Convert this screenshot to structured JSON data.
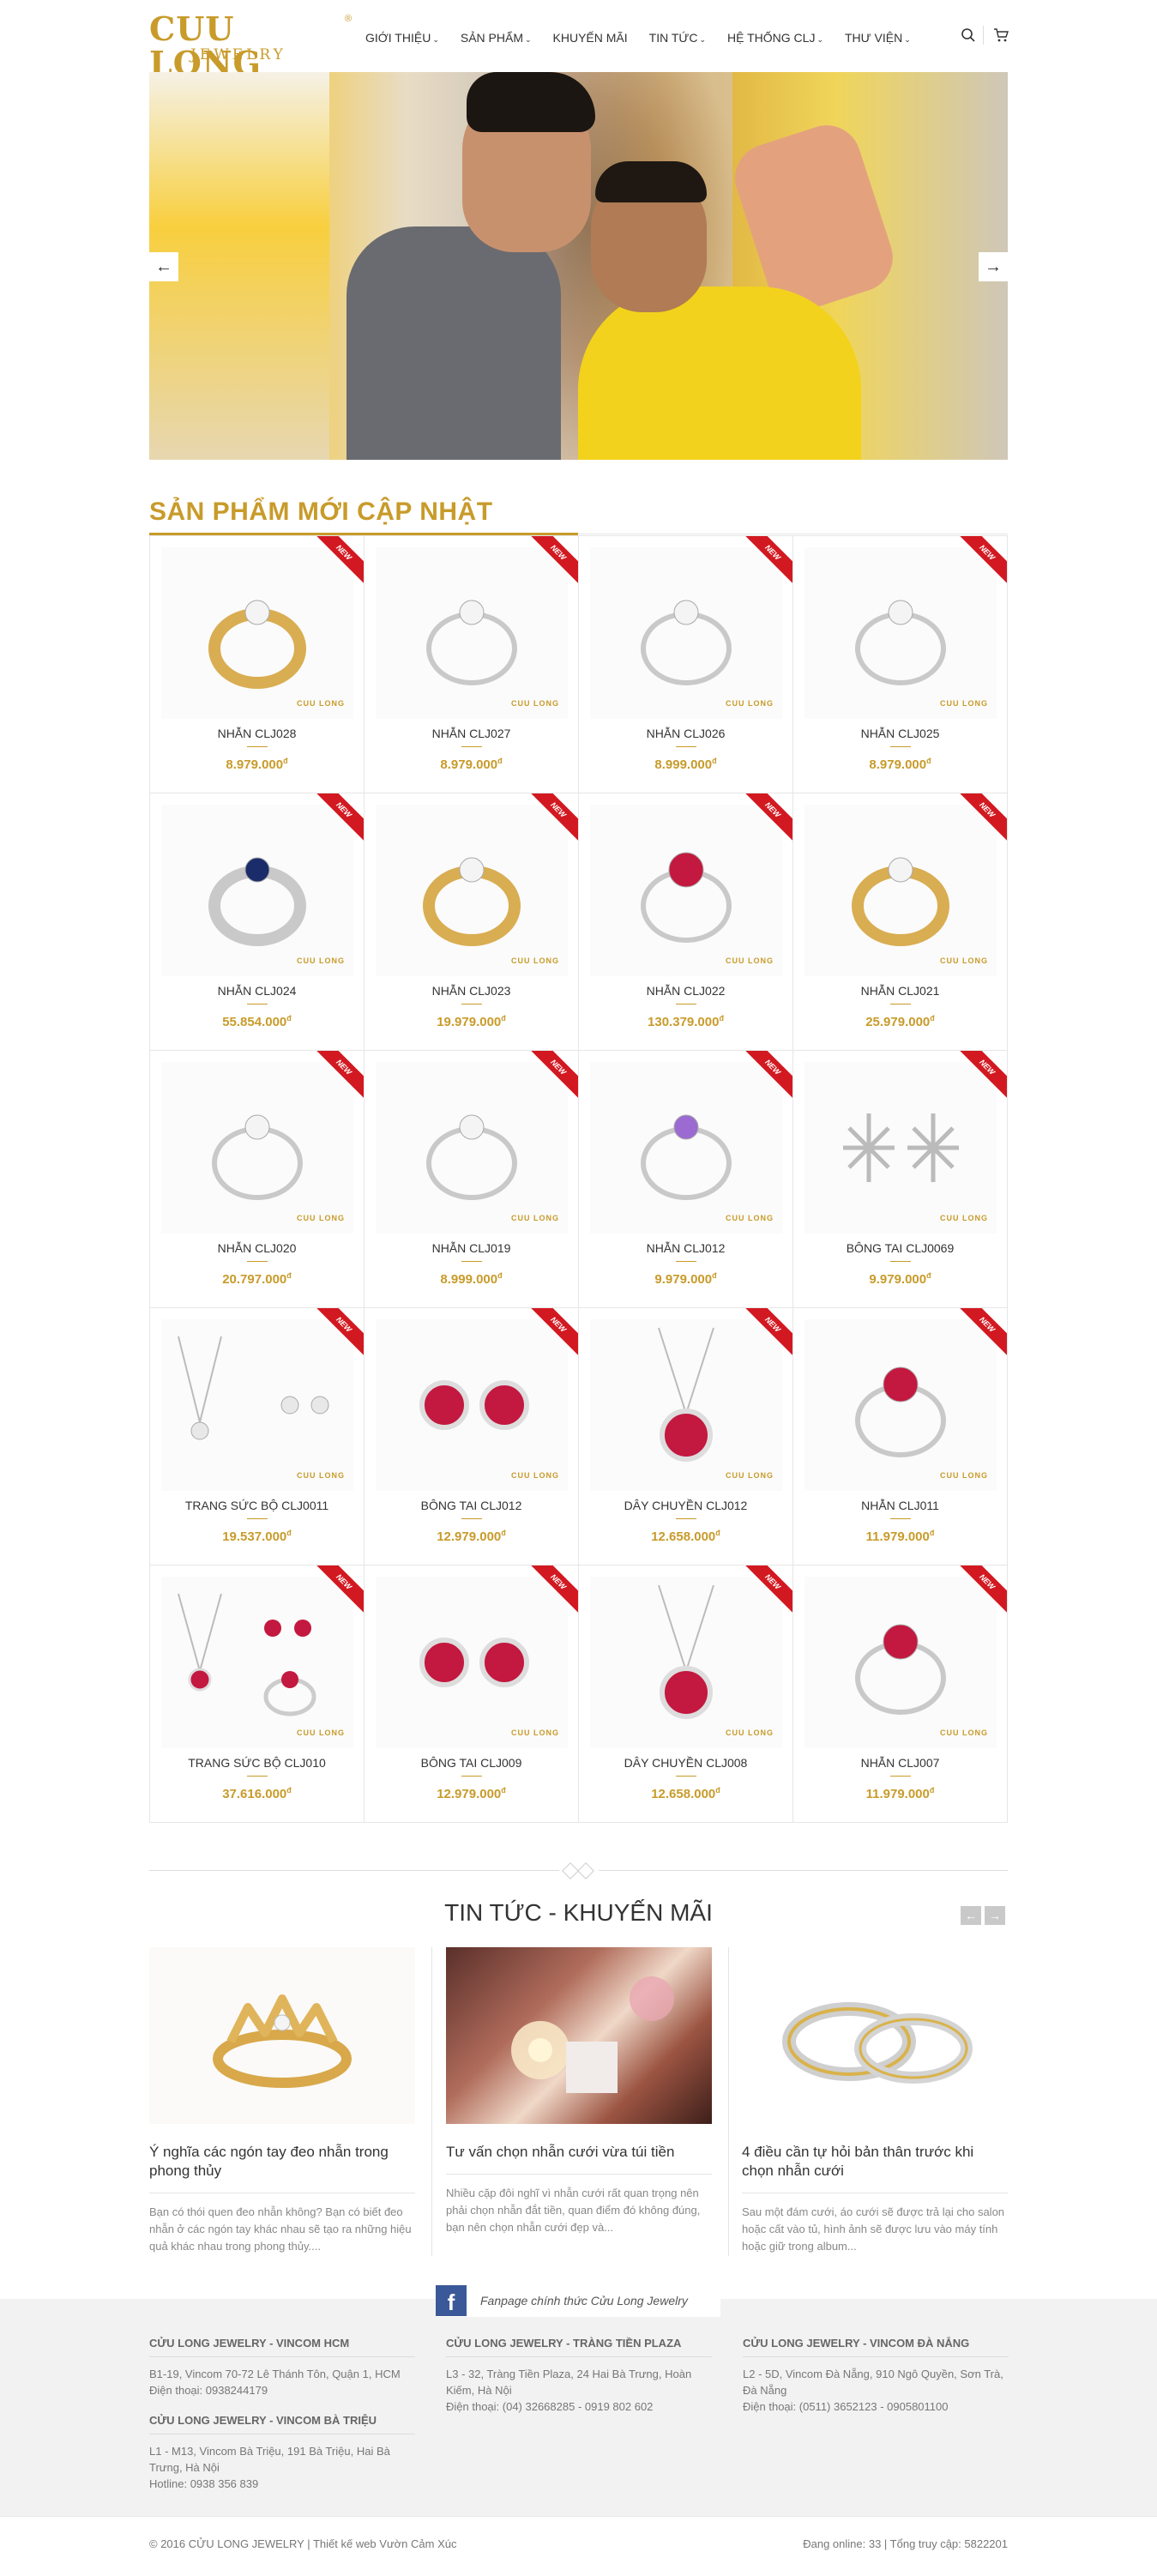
{
  "header": {
    "logo_main": "CUU LONG",
    "logo_sub": "JEWELRY",
    "logo_reg": "®",
    "nav": [
      {
        "label": "GIỚI THIỆU",
        "has_dropdown": true
      },
      {
        "label": "SẢN PHẨM",
        "has_dropdown": true
      },
      {
        "label": "KHUYẾN MÃI",
        "has_dropdown": false
      },
      {
        "label": "TIN TỨC",
        "has_dropdown": true
      },
      {
        "label": "HỆ THỐNG CLJ",
        "has_dropdown": true
      },
      {
        "label": "THƯ VIỆN",
        "has_dropdown": true
      }
    ],
    "icons": [
      "search-icon",
      "cart-icon"
    ]
  },
  "banner": {
    "prev": "←",
    "next": "→"
  },
  "products": {
    "title": "SẢN PHẨM MỚI CẬP NHẬT",
    "badge": "NEW",
    "card_logo": "CUU LONG",
    "currency": "đ",
    "items": [
      {
        "name": "NHẪN CLJ028",
        "price": "8.979.000",
        "kind": "ring-gold"
      },
      {
        "name": "NHẪN CLJ027",
        "price": "8.979.000",
        "kind": "ring-silver"
      },
      {
        "name": "NHẪN CLJ026",
        "price": "8.999.000",
        "kind": "ring-silver"
      },
      {
        "name": "NHẪN CLJ025",
        "price": "8.979.000",
        "kind": "ring-silver"
      },
      {
        "name": "NHẪN CLJ024",
        "price": "55.854.000",
        "kind": "ring-blue"
      },
      {
        "name": "NHẪN CLJ023",
        "price": "19.979.000",
        "kind": "ring-gold"
      },
      {
        "name": "NHẪN CLJ022",
        "price": "130.379.000",
        "kind": "ring-red"
      },
      {
        "name": "NHẪN CLJ021",
        "price": "25.979.000",
        "kind": "ring-gold"
      },
      {
        "name": "NHẪN CLJ020",
        "price": "20.797.000",
        "kind": "ring-silver"
      },
      {
        "name": "NHẪN CLJ019",
        "price": "8.999.000",
        "kind": "ring-silver"
      },
      {
        "name": "NHẪN CLJ012",
        "price": "9.979.000",
        "kind": "ring-purple"
      },
      {
        "name": "BÔNG TAI CLJ0069",
        "price": "9.979.000",
        "kind": "earring-star"
      },
      {
        "name": "TRANG SỨC BỘ CLJ0011",
        "price": "19.537.000",
        "kind": "set-silver"
      },
      {
        "name": "BÔNG TAI CLJ012",
        "price": "12.979.000",
        "kind": "earring-red"
      },
      {
        "name": "DÂY CHUYỀN CLJ012",
        "price": "12.658.000",
        "kind": "necklace-red"
      },
      {
        "name": "NHẪN CLJ011",
        "price": "11.979.000",
        "kind": "ring-red"
      },
      {
        "name": "TRANG SỨC BỘ CLJ010",
        "price": "37.616.000",
        "kind": "set-red"
      },
      {
        "name": "BÔNG TAI CLJ009",
        "price": "12.979.000",
        "kind": "earring-red"
      },
      {
        "name": "DÂY CHUYỀN CLJ008",
        "price": "12.658.000",
        "kind": "necklace-red"
      },
      {
        "name": "NHẪN CLJ007",
        "price": "11.979.000",
        "kind": "ring-red"
      }
    ]
  },
  "news": {
    "title": "TIN TỨC - KHUYẾN MÃI",
    "prev": "←",
    "next": "→",
    "items": [
      {
        "title": "Ý nghĩa các ngón tay đeo nhẫn trong phong thủy",
        "excerpt": "Bạn có thói quen đeo nhẫn không? Bạn có biết đeo nhẫn ở các ngón tay khác nhau sẽ tạo ra những hiệu quả khác nhau trong phong thủy...."
      },
      {
        "title": "Tư vấn chọn nhẫn cưới vừa túi tiền",
        "excerpt": "Nhiều cặp đôi nghĩ vì nhẫn cưới rất quan trọng nên phải chọn nhẫn đắt tiền, quan điểm đó không đúng, bạn nên chọn nhẫn cưới đẹp và..."
      },
      {
        "title": "4 điều cần tự hỏi bản thân trước khi chọn nhẫn cưới",
        "excerpt": "Sau một đám cưới, áo cưới sẽ được trả lại cho salon hoặc cất vào tủ, hình ảnh sẽ được lưu vào máy tính hoặc giữ trong album..."
      }
    ]
  },
  "footer": {
    "fanpage": "Fanpage chính thức Cửu Long Jewelry",
    "fb_letter": "f",
    "stores": [
      {
        "name": "CỬU LONG JEWELRY - VINCOM HCM",
        "lines": [
          "B1-19, Vincom 70-72 Lê Thánh Tôn, Quận 1, HCM",
          "Điện thoại: 0938244179"
        ]
      },
      {
        "name": "CỬU LONG JEWELRY - TRÀNG TIỀN PLAZA",
        "lines": [
          "L3 - 32, Tràng Tiền Plaza, 24 Hai Bà Trưng, Hoàn Kiếm, Hà Nội",
          "Điện thoại: (04) 32668285 - 0919 802 602"
        ]
      },
      {
        "name": "CỬU LONG JEWELRY - VINCOM ĐÀ NẴNG",
        "lines": [
          "L2 - 5D, Vincom Đà Nẵng, 910 Ngô Quyền, Sơn Trà, Đà Nẵng",
          "Điện thoại: (0511) 3652123 - 0905801100"
        ]
      },
      {
        "name": "CỬU LONG JEWELRY - VINCOM BÀ TRIỆU",
        "lines": [
          "L1 - M13, Vincom Bà Triệu, 191 Bà Triệu, Hai Bà Trưng, Hà Nội",
          "Hotline: 0938 356 839"
        ]
      }
    ],
    "copyright": "© 2016 CỬU LONG JEWELRY | Thiết kế web Vườn Cảm Xúc",
    "stats": "Đang online: 33 | Tổng truy cập: 5822201"
  },
  "colors": {
    "brand_gold": "#c89b2a",
    "badge_red": "#d21921",
    "footer_bg": "#f2f2f2"
  }
}
